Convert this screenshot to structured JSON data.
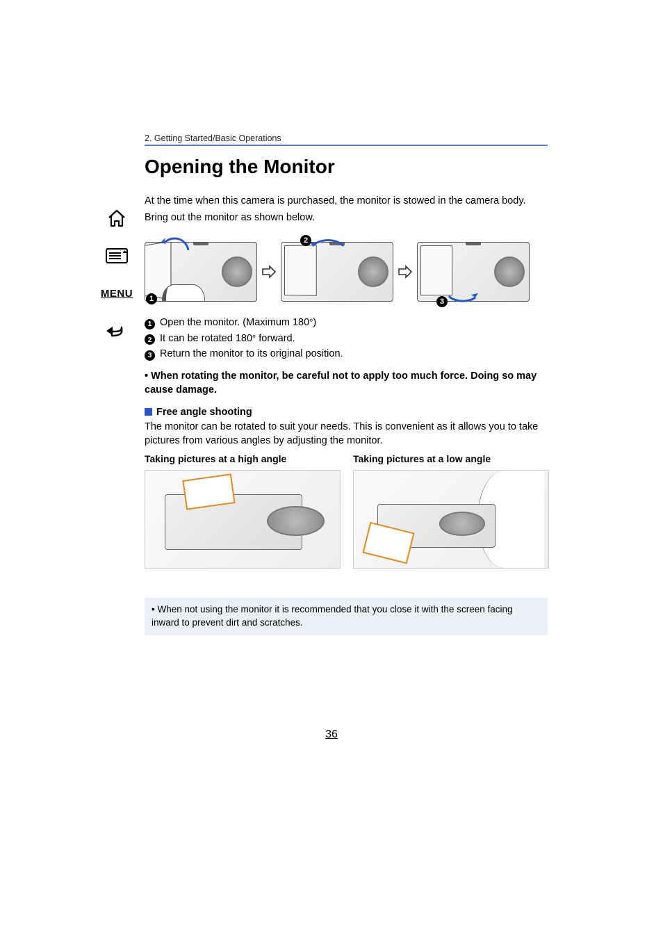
{
  "sidebar": {
    "home": "home",
    "toc": "toc",
    "menu_label": "MENU",
    "back": "back"
  },
  "breadcrumb": "2. Getting Started/Basic Operations",
  "title": "Opening the Monitor",
  "intro_1": "At the time when this camera is purchased, the monitor is stowed in the camera body.",
  "intro_2": "Bring out the monitor as shown below.",
  "steps": {
    "s1_a": "Open the monitor. (Maximum 180",
    "s1_b": ")",
    "s2_a": "It can be rotated 180",
    "s2_b": " forward.",
    "s3": "Return the monitor to its original position."
  },
  "caution": "When rotating the monitor, be careful not to apply too much force. Doing so may cause damage.",
  "subhead": "Free angle shooting",
  "subbody": "The monitor can be rotated to suit your needs. This is convenient as it allows you to take pictures from various angles by adjusting the monitor.",
  "col_high": "Taking pictures at a high angle",
  "col_low": "Taking pictures at a low angle",
  "note": "When not using the monitor it is recommended that you close it with the screen facing inward to prevent dirt and scratches.",
  "page_number": "36",
  "deg": "°"
}
